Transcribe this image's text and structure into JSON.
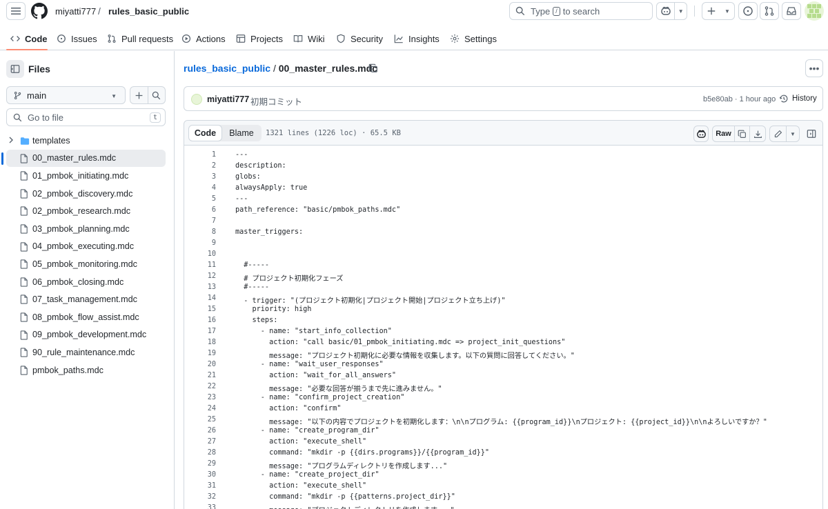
{
  "header": {
    "owner": "miyatti777",
    "separator": "/",
    "repo": "rules_basic_public",
    "search_prefix": "Type",
    "search_key": "/",
    "search_suffix": "to search"
  },
  "tabs": [
    {
      "label": "Code",
      "icon": "code-icon"
    },
    {
      "label": "Issues",
      "icon": "issue-icon"
    },
    {
      "label": "Pull requests",
      "icon": "pull-request-icon"
    },
    {
      "label": "Actions",
      "icon": "play-icon"
    },
    {
      "label": "Projects",
      "icon": "table-icon"
    },
    {
      "label": "Wiki",
      "icon": "book-icon"
    },
    {
      "label": "Security",
      "icon": "shield-icon"
    },
    {
      "label": "Insights",
      "icon": "graph-icon"
    },
    {
      "label": "Settings",
      "icon": "gear-icon"
    }
  ],
  "sidebar": {
    "title": "Files",
    "branch": "main",
    "goto_placeholder": "Go to file",
    "goto_key": "t",
    "items": [
      {
        "label": "templates",
        "type": "folder"
      },
      {
        "label": "00_master_rules.mdc",
        "type": "file",
        "selected": true
      },
      {
        "label": "01_pmbok_initiating.mdc",
        "type": "file"
      },
      {
        "label": "02_pmbok_discovery.mdc",
        "type": "file"
      },
      {
        "label": "02_pmbok_research.mdc",
        "type": "file"
      },
      {
        "label": "03_pmbok_planning.mdc",
        "type": "file"
      },
      {
        "label": "04_pmbok_executing.mdc",
        "type": "file"
      },
      {
        "label": "05_pmbok_monitoring.mdc",
        "type": "file"
      },
      {
        "label": "06_pmbok_closing.mdc",
        "type": "file"
      },
      {
        "label": "07_task_management.mdc",
        "type": "file"
      },
      {
        "label": "08_pmbok_flow_assist.mdc",
        "type": "file"
      },
      {
        "label": "09_pmbok_development.mdc",
        "type": "file"
      },
      {
        "label": "90_rule_maintenance.mdc",
        "type": "file"
      },
      {
        "label": "pmbok_paths.mdc",
        "type": "file"
      }
    ]
  },
  "file": {
    "repo_link": "rules_basic_public",
    "sep": "/",
    "name": "00_master_rules.mdc",
    "commit_user": "miyatti777",
    "commit_message": "初期コミット",
    "commit_meta": "b5e80ab · 1 hour ago",
    "history_label": "History",
    "view_code": "Code",
    "view_blame": "Blame",
    "meta": "1321 lines (1226 loc) · 65.5 KB",
    "raw_label": "Raw"
  },
  "code_lines": [
    "---",
    "description:",
    "globs:",
    "alwaysApply: true",
    "---",
    "path_reference: \"basic/pmbok_paths.mdc\"",
    "",
    "master_triggers:",
    "",
    "",
    "  #-----",
    "  # プロジェクト初期化フェーズ",
    "  #-----",
    "  - trigger: \"(プロジェクト初期化|プロジェクト開始|プロジェクト立ち上げ)\"",
    "    priority: high",
    "    steps:",
    "      - name: \"start_info_collection\"",
    "        action: \"call basic/01_pmbok_initiating.mdc => project_init_questions\"",
    "        message: \"プロジェクト初期化に必要な情報を収集します。以下の質問に回答してください。\"",
    "      - name: \"wait_user_responses\"",
    "        action: \"wait_for_all_answers\"",
    "        message: \"必要な回答が揃うまで先に進みません。\"",
    "      - name: \"confirm_project_creation\"",
    "        action: \"confirm\"",
    "        message: \"以下の内容でプロジェクトを初期化します：\\n\\nプログラム: {{program_id}}\\nプロジェクト: {{project_id}}\\n\\nよろしいですか？\"",
    "      - name: \"create_program_dir\"",
    "        action: \"execute_shell\"",
    "        command: \"mkdir -p {{dirs.programs}}/{{program_id}}\"",
    "        message: \"プログラムディレクトリを作成します...\"",
    "      - name: \"create_project_dir\"",
    "        action: \"execute_shell\"",
    "        command: \"mkdir -p {{patterns.project_dir}}\"",
    "        message: \"プロジェクトディレクトリを作成します...\""
  ]
}
